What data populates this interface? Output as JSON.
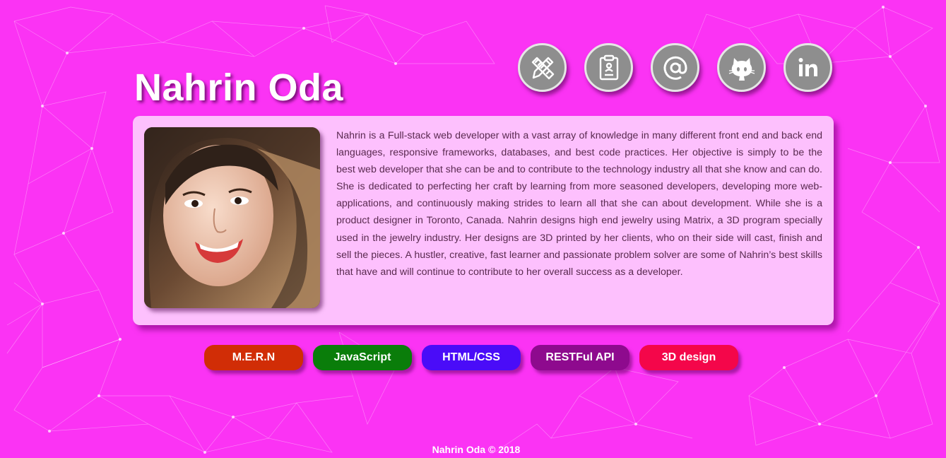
{
  "profile": {
    "name": "Nahrin Oda",
    "bio": "Nahrin is a Full-stack web developer with a vast array of knowledge in many different front end and back end languages, responsive frameworks, databases, and best code practices. Her objective is simply to be the best web developer that she can be and to contribute to the technology industry all that she know and can do. She is dedicated to perfecting her craft by learning from more seasoned developers, developing more web-applications, and continuously making strides to learn all that she can about development. While she is a product designer in Toronto, Canada. Nahrin designs high end jewelry using Matrix, a 3D program specially used in the jewelry industry. Her designs are 3D printed by her clients, who on their side will cast, finish and sell the pieces. A hustler, creative, fast learner and passionate problem solver are some of Nahrin’s best skills that have and will continue to contribute to her overall success as a developer."
  },
  "social_icons": [
    {
      "icon": "design-tools-icon"
    },
    {
      "icon": "resume-clipboard-icon"
    },
    {
      "icon": "email-at-icon"
    },
    {
      "icon": "github-icon"
    },
    {
      "icon": "linkedin-icon"
    }
  ],
  "skills": [
    {
      "label": "M.E.R.N",
      "color": "#d12d06"
    },
    {
      "label": "JavaScript",
      "color": "#0a7d0a"
    },
    {
      "label": "HTML/CSS",
      "color": "#4a0cf8"
    },
    {
      "label": "RESTFul API",
      "color": "#8e0a8e"
    },
    {
      "label": "3D design",
      "color": "#f4064a"
    }
  ],
  "footer": {
    "text": "Nahrin Oda © 2018"
  },
  "colors": {
    "background": "#fb33f4",
    "card": "#fdc0fd",
    "icon_circle": "#8e8e8e"
  }
}
